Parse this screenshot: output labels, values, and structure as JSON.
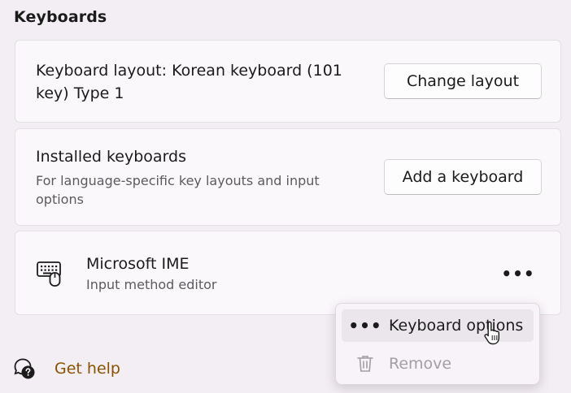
{
  "section": {
    "title": "Keyboards"
  },
  "layout_card": {
    "text": "Keyboard layout: Korean keyboard (101 key) Type 1",
    "button_label": "Change layout"
  },
  "installed_card": {
    "title": "Installed keyboards",
    "subtitle": "For language-specific key layouts and input options",
    "button_label": "Add a keyboard"
  },
  "ime_card": {
    "title": "Microsoft IME",
    "subtitle": "Input method editor",
    "icon": "keyboard-icon",
    "more_label": "•••"
  },
  "context_menu": {
    "items": [
      {
        "label": "Keyboard options",
        "icon": "more-icon",
        "state": "hover"
      },
      {
        "label": "Remove",
        "icon": "trash-icon",
        "state": "disabled"
      }
    ],
    "dots": "•••"
  },
  "help": {
    "label": "Get help",
    "icon": "help-chat-icon"
  },
  "colors": {
    "background": "#f3eef4",
    "card": "#fbf8fb",
    "link": "#8a5200",
    "disabled_text": "#a29ea4"
  }
}
